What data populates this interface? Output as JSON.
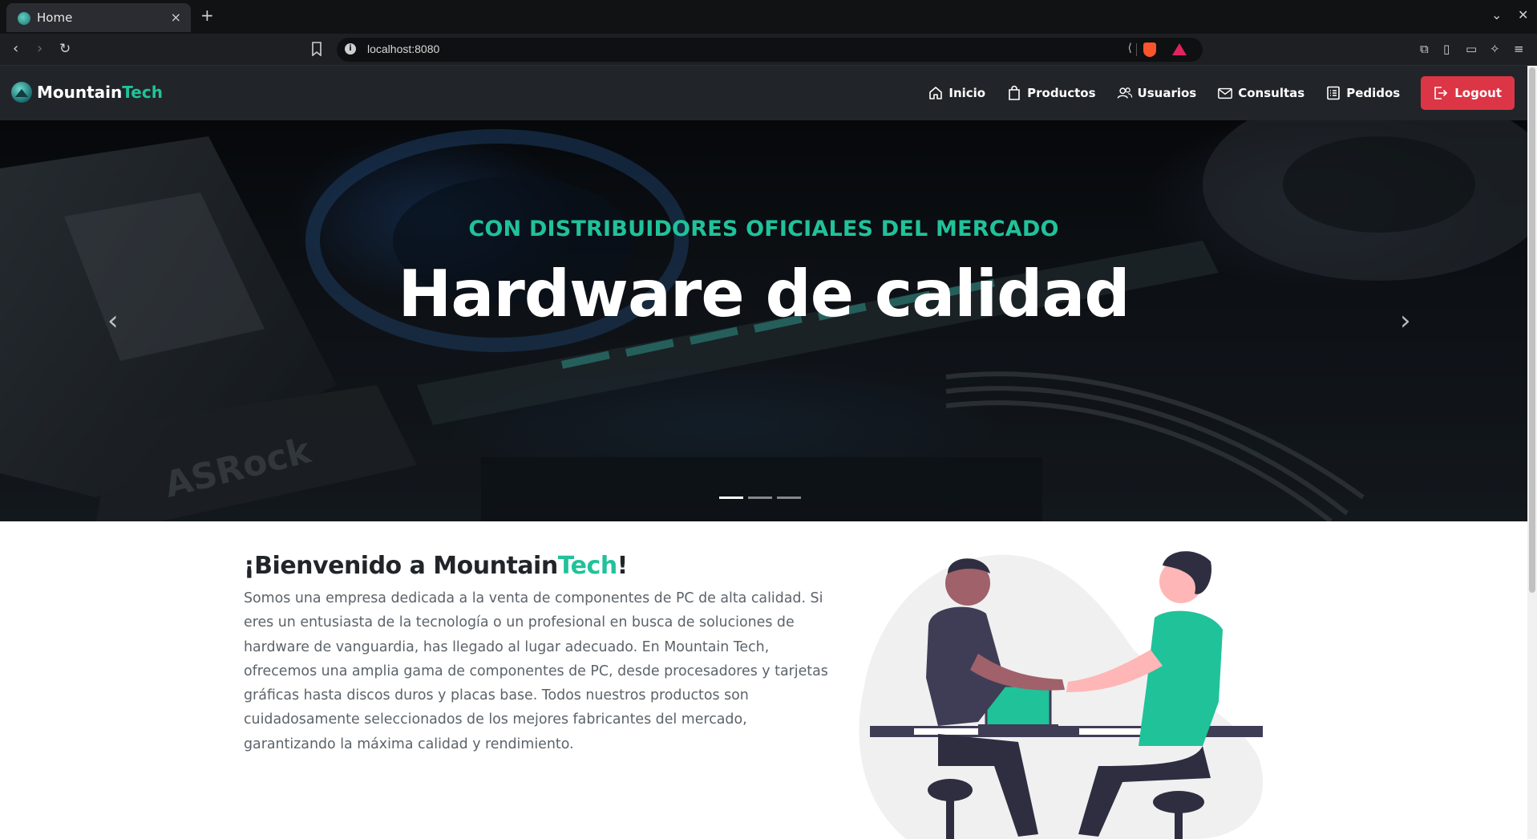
{
  "browser": {
    "tab_title": "Home",
    "tab_close": "×",
    "new_tab": "+",
    "url": "localhost:8080"
  },
  "site": {
    "brand": {
      "name": "Mountain",
      "accent": "Tech"
    },
    "nav": [
      {
        "label": "Inicio",
        "icon": "home-icon"
      },
      {
        "label": "Productos",
        "icon": "shopping-bag-icon"
      },
      {
        "label": "Usuarios",
        "icon": "users-icon"
      },
      {
        "label": "Consultas",
        "icon": "envelope-icon"
      },
      {
        "label": "Pedidos",
        "icon": "list-icon"
      }
    ],
    "logout_label": "Logout"
  },
  "hero": {
    "subtitle": "CON DISTRIBUIDORES OFICIALES DEL MERCADO",
    "title": "Hardware de calidad",
    "slides": 3,
    "active_slide": 0
  },
  "welcome": {
    "heading_prefix": "¡Bienvenido a Mountain",
    "heading_accent": "Tech",
    "heading_suffix": "!",
    "body": "Somos una empresa dedicada a la venta de componentes de PC de alta calidad. Si eres un entusiasta de la tecnología o un profesional en busca de soluciones de hardware de vanguardia, has llegado al lugar adecuado. En Mountain Tech, ofrecemos una amplia gama de componentes de PC, desde procesadores y tarjetas gráficas hasta discos duros y placas base. Todos nuestros productos son cuidadosamente seleccionados de los mejores fabricantes del mercado, garantizando la máxima calidad y rendimiento."
  },
  "colors": {
    "accent": "#20c29a",
    "navbar": "#212529",
    "logout": "#dc3545"
  }
}
